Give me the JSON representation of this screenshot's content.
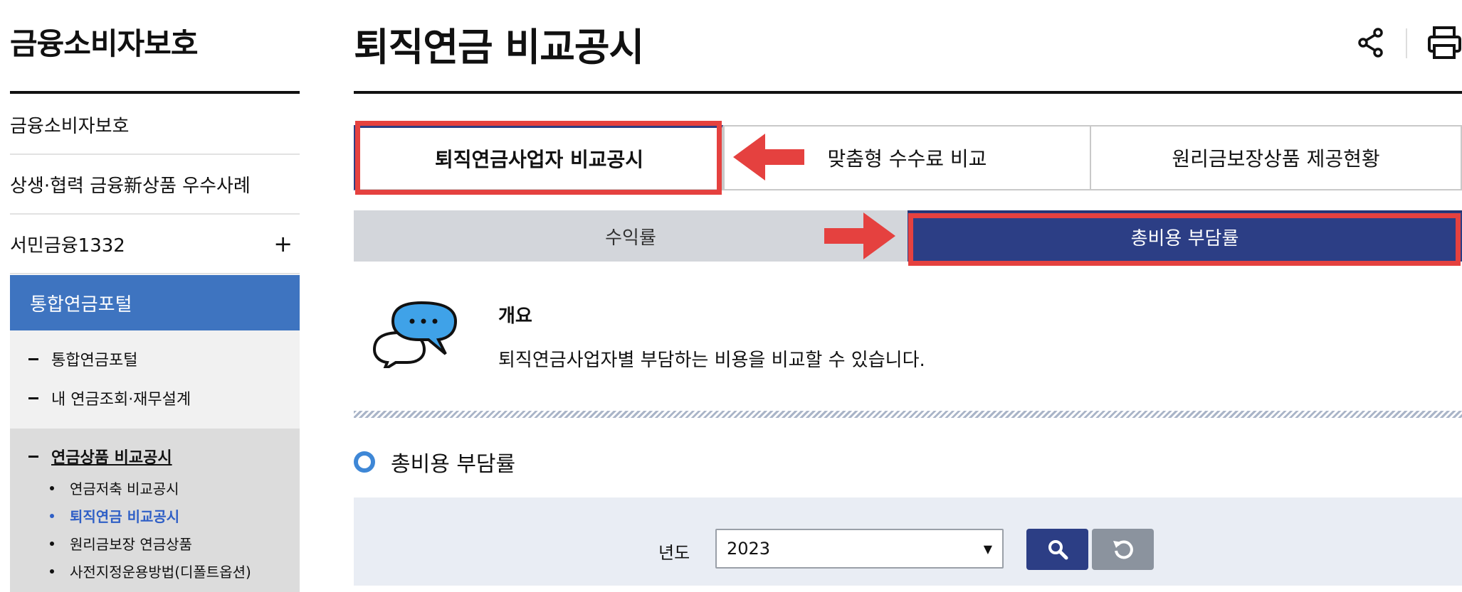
{
  "sidebar": {
    "title": "금융소비자보호",
    "items": [
      {
        "label": "금융소비자보호"
      },
      {
        "label": "상생·협력 금융新상품 우수사례"
      },
      {
        "label": "서민금융1332",
        "toggle": "+"
      }
    ],
    "active_section": "통합연금포털",
    "sub_items": [
      "통합연금포털",
      "내 연금조회·재무설계",
      "연금상품 비교공시"
    ],
    "leaf_items": [
      "연금저축 비교공시",
      "퇴직연금 비교공시",
      "원리금보장 연금상품",
      "사전지정운용방법(디폴트옵션)"
    ],
    "active_leaf": "퇴직연금 비교공시"
  },
  "header": {
    "title": "퇴직연금 비교공시",
    "icons": [
      "share-icon",
      "print-icon"
    ]
  },
  "tabs": [
    {
      "label": "퇴직연금사업자 비교공시",
      "active": true
    },
    {
      "label": "맞춤형 수수료 비교",
      "active": false
    },
    {
      "label": "원리금보장상품 제공현황",
      "active": false
    }
  ],
  "subtabs": [
    {
      "label": "수익률",
      "active": false
    },
    {
      "label": "총비용 부담률",
      "active": true
    }
  ],
  "overview": {
    "label": "개요",
    "text": "퇴직연금사업자별 부담하는 비용을 비교할 수 있습니다.",
    "icon": "chat-bubbles-icon"
  },
  "section": {
    "title": "총비용 부담률"
  },
  "filter": {
    "year_label": "년도",
    "year_value": "2023",
    "search_icon": "search-icon",
    "reset_icon": "refresh-icon"
  },
  "colors": {
    "accent": "#3e74c0",
    "navy": "#2c3e85",
    "highlight": "#e5413f"
  }
}
